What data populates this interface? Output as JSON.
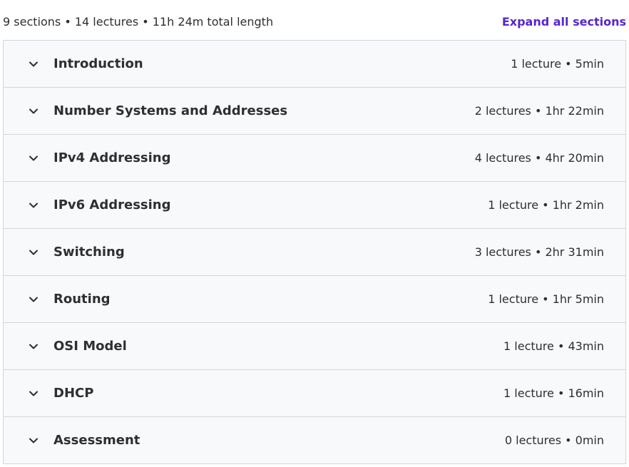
{
  "summary": {
    "text": "9 sections • 14 lectures • 11h 24m total length",
    "expand_all_label": "Expand all sections"
  },
  "colors": {
    "accent": "#5624d0",
    "row_background": "#f7f9fa",
    "border": "#d1d7dc",
    "text": "#2d2f31"
  },
  "sections": [
    {
      "title": "Introduction",
      "meta": "1 lecture • 5min",
      "icon": "chevron-down-icon"
    },
    {
      "title": "Number Systems and Addresses",
      "meta": "2 lectures • 1hr 22min",
      "icon": "chevron-down-icon"
    },
    {
      "title": "IPv4 Addressing",
      "meta": "4 lectures • 4hr 20min",
      "icon": "chevron-down-icon"
    },
    {
      "title": "IPv6 Addressing",
      "meta": "1 lecture • 1hr 2min",
      "icon": "chevron-down-icon"
    },
    {
      "title": "Switching",
      "meta": "3 lectures • 2hr 31min",
      "icon": "chevron-down-icon"
    },
    {
      "title": "Routing",
      "meta": "1 lecture • 1hr 5min",
      "icon": "chevron-down-icon"
    },
    {
      "title": "OSI Model",
      "meta": "1 lecture • 43min",
      "icon": "chevron-down-icon"
    },
    {
      "title": "DHCP",
      "meta": "1 lecture • 16min",
      "icon": "chevron-down-icon"
    },
    {
      "title": "Assessment",
      "meta": "0 lectures • 0min",
      "icon": "chevron-down-icon"
    }
  ]
}
